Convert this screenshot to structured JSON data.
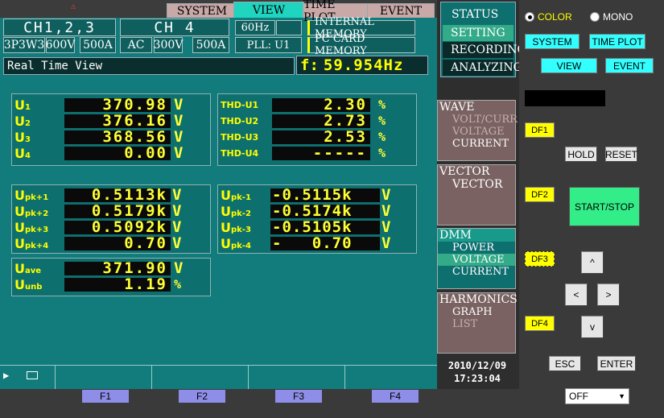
{
  "tabs": {
    "system": "SYSTEM",
    "view": "VIEW",
    "time_plot": "TIME PLOT",
    "event": "EVENT"
  },
  "header": {
    "ch123_title": "CH1,2,3",
    "ch123_wiring": "3P3W3",
    "ch123_voltage": "600V",
    "ch123_current": "500A",
    "ch4_title": "CH 4",
    "ch4_mode": "AC",
    "ch4_voltage": "300V",
    "ch4_current": "500A",
    "freq": "60Hz",
    "pll": "PLL: U1",
    "mem_internal": "INTERNAL MEMORY",
    "mem_card": "PC CARD  MEMORY",
    "view_name": "Real Time View",
    "freq_label": "f:",
    "freq_value": "59.954Hz"
  },
  "rms": [
    {
      "label": "U",
      "sub": "1",
      "value": "370.98",
      "unit": "V"
    },
    {
      "label": "U",
      "sub": "2",
      "value": "376.16",
      "unit": "V"
    },
    {
      "label": "U",
      "sub": "3",
      "value": "368.56",
      "unit": "V"
    },
    {
      "label": "U",
      "sub": "4",
      "value": "0.00",
      "unit": "V"
    }
  ],
  "thd": [
    {
      "label": "THD-U1",
      "value": "2.30",
      "unit": "%"
    },
    {
      "label": "THD-U2",
      "value": "2.73",
      "unit": "%"
    },
    {
      "label": "THD-U3",
      "value": "2.53",
      "unit": "%"
    },
    {
      "label": "THD-U4",
      "value": "-----",
      "unit": "%"
    }
  ],
  "peak_pos": [
    {
      "label": "U",
      "sub": "pk+1",
      "value": "0.5113k",
      "unit": "V"
    },
    {
      "label": "U",
      "sub": "pk+2",
      "value": "0.5179k",
      "unit": "V"
    },
    {
      "label": "U",
      "sub": "pk+3",
      "value": "0.5092k",
      "unit": "V"
    },
    {
      "label": "U",
      "sub": "pk+4",
      "value": "0.70",
      "unit": "V"
    }
  ],
  "peak_neg": [
    {
      "label": "U",
      "sub": "pk-1",
      "value": "-0.5115k",
      "unit": "V"
    },
    {
      "label": "U",
      "sub": "pk-2",
      "value": "-0.5174k",
      "unit": "V"
    },
    {
      "label": "U",
      "sub": "pk-3",
      "value": "-0.5105k",
      "unit": "V"
    },
    {
      "label": "U",
      "sub": "pk-4",
      "value": "-   0.70",
      "unit": "V"
    }
  ],
  "avg": [
    {
      "label": "U",
      "sub": "ave",
      "value": "371.90",
      "unit": "V"
    },
    {
      "label": "U",
      "sub": "unb",
      "value": "1.19",
      "unit": "%"
    }
  ],
  "status_menu": {
    "status": "STATUS",
    "setting": "SETTING",
    "recording": "RECORDING",
    "analyzing": "ANALYZING"
  },
  "side": {
    "wave_title": "WAVE",
    "wave_items": [
      "VOLT/CURR",
      "VOLTAGE",
      "CURRENT"
    ],
    "vector_title": "VECTOR",
    "vector_items": [
      "VECTOR"
    ],
    "dmm_title": "DMM",
    "dmm_items": [
      "POWER",
      "VOLTAGE",
      "CURRENT"
    ],
    "harm_title": "HARMONICS",
    "harm_items": [
      "GRAPH",
      "LIST"
    ],
    "date": "2010/12/09",
    "time": "17:23:04"
  },
  "fkeys": [
    "F1",
    "F2",
    "F3",
    "F4"
  ],
  "controls": {
    "color": "COLOR",
    "mono": "MONO",
    "system": "SYSTEM",
    "time_plot": "TIME PLOT",
    "view": "VIEW",
    "event": "EVENT",
    "df1": "DF1",
    "df2": "DF2",
    "df3": "DF3",
    "df4": "DF4",
    "hold": "HOLD",
    "reset": "RESET",
    "start_stop": "START/STOP",
    "up": "^",
    "left": "<",
    "right": ">",
    "down": "v",
    "esc": "ESC",
    "enter": "ENTER",
    "power_select": "OFF"
  },
  "colors": {
    "screen_bg": "#127b7b",
    "lcd_yellow": "#ffff00",
    "tab_active": "#1fd5c0",
    "side_active": "#33aa88",
    "side_panel": "#7a6262"
  }
}
